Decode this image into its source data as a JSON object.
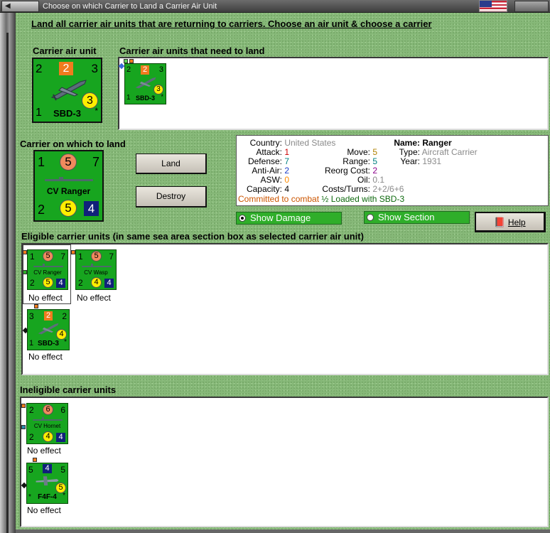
{
  "window": {
    "button_label": "",
    "title": "Choose on which Carrier to Land a Carrier Air Unit"
  },
  "instruction": "Land all carrier air units that are returning to carriers.  Choose an air unit & choose a carrier",
  "air_unit": {
    "label": "Carrier air unit",
    "top_left": "2",
    "top_mid": "2",
    "top_right": "3",
    "bottom_left": "1",
    "circle": "3",
    "name": "SBD-3",
    "star": "*"
  },
  "need_to_land": {
    "label": "Carrier air units that need to land",
    "units": [
      {
        "top_left": "2",
        "top_mid": "2",
        "top_right": "3",
        "circle": "3",
        "bottom_left": "1",
        "name": "SBD-3",
        "star": "*"
      }
    ]
  },
  "carrier": {
    "label": "Carrier on which to land",
    "top_left": "1",
    "top_mid": "5",
    "top_right": "7",
    "name": "CV Ranger",
    "bottom_left": "2",
    "circle": "5",
    "square": "4"
  },
  "buttons": {
    "land": "Land",
    "destroy": "Destroy",
    "help": "Help"
  },
  "info": {
    "country_label": "Country:",
    "country": "United States",
    "attack_label": "Attack:",
    "attack": "1",
    "defense_label": "Defense:",
    "defense": "7",
    "antiair_label": "Anti-Air:",
    "antiair": "2",
    "asw_label": "ASW:",
    "asw": "0",
    "capacity_label": "Capacity:",
    "capacity": "4",
    "move_label": "Move:",
    "move": "5",
    "range_label": "Range:",
    "range": "5",
    "reorg_label": "Reorg Cost:",
    "reorg": "2",
    "oil_label": "Oil:",
    "oil": "0.1",
    "costs_label": "Costs/Turns:",
    "costs": "2+2/6+6",
    "name_label": "Name:",
    "name": "Ranger",
    "type_label": "Type:",
    "type": "Aircraft Carrier",
    "year_label": "Year:",
    "year": "1931",
    "committed": "Committed to combat",
    "loaded": "½ Loaded with SBD-3"
  },
  "options": {
    "show_damage": "Show Damage",
    "show_section": "Show Section",
    "show_damage_selected": true
  },
  "eligible": {
    "label": "Eligible carrier units (in same sea area section box as selected carrier air unit)",
    "units": [
      {
        "kind": "carrier",
        "top_left": "1",
        "top_mid": "5",
        "top_right": "7",
        "name": "CV Ranger",
        "bottom_left": "2",
        "circle": "5",
        "square": "4",
        "caption": "No effect"
      },
      {
        "kind": "carrier",
        "top_left": "1",
        "top_mid": "5",
        "top_right": "7",
        "name": "CV Wasp",
        "bottom_left": "2",
        "circle": "4",
        "square": "4",
        "caption": "No effect"
      },
      {
        "kind": "air",
        "top_left": "3",
        "top_mid": "2",
        "top_right": "2",
        "circle": "4",
        "bottom_left": "1",
        "name": "SBD-3",
        "star": "*",
        "caption": "No effect"
      }
    ]
  },
  "ineligible": {
    "label": "Ineligible carrier units",
    "units": [
      {
        "kind": "carrier",
        "top_left": "2",
        "top_mid": "6",
        "top_right": "6",
        "name": "CV Hornet",
        "bottom_left": "2",
        "circle": "4",
        "square": "4",
        "caption": "No effect"
      },
      {
        "kind": "air",
        "top_left": "5",
        "top_mid": "4",
        "top_right": "5",
        "circle": "5",
        "bottom_left": "*",
        "name": "F4F-4",
        "star": "*",
        "caption": "No effect"
      }
    ]
  },
  "colors": {
    "counter_green": "#17a51f",
    "orange": "#f07b1e",
    "salmon": "#f08a5d",
    "yellow": "#ffee00",
    "navy": "#10207a",
    "committed": "#cc5500",
    "loaded": "#0f6a0f",
    "attack": "#cc0000",
    "defense": "#008080",
    "antiair": "#1a3cc8",
    "asw": "#ff8c00",
    "move": "#b08000",
    "range": "#008080",
    "reorg": "#8b008b",
    "grey": "#8a8a8a"
  }
}
